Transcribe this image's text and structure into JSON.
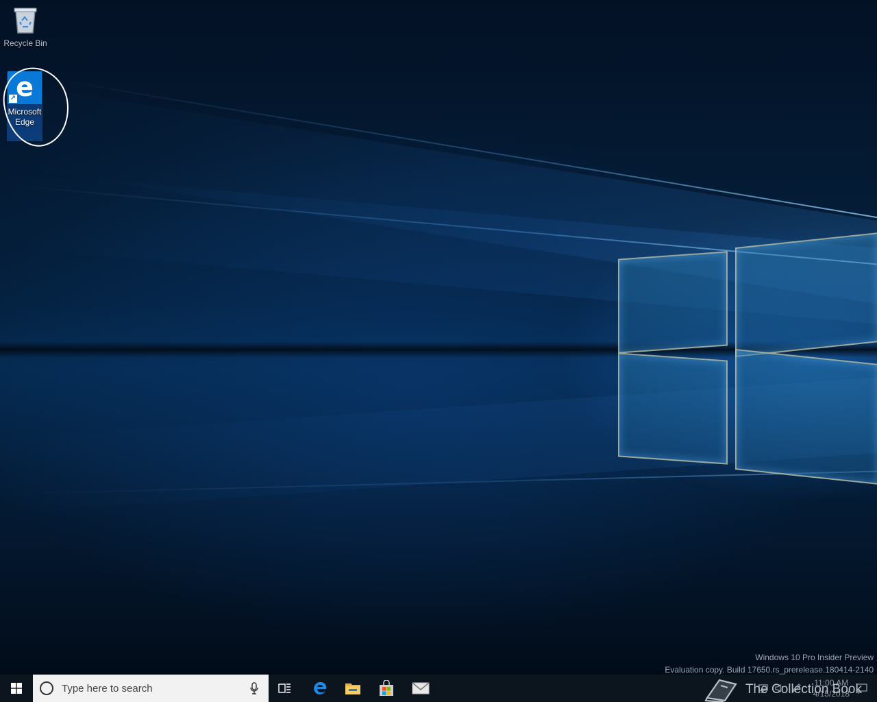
{
  "desktop": {
    "icons": [
      {
        "label": "Recycle Bin",
        "icon": "recycle-bin-icon"
      },
      {
        "label": "Microsoft Edge",
        "label_line1": "Microsoft",
        "label_line2": "Edge",
        "icon": "edge-icon"
      }
    ],
    "watermark": {
      "line1": "Windows 10 Pro Insider Preview",
      "line2": "Evaluation copy. Build 17650.rs_prerelease.180414-2140"
    },
    "annotation_color": "#ffffff"
  },
  "taskbar": {
    "search": {
      "placeholder": "Type here to search"
    },
    "pinned": [
      {
        "name": "task-view",
        "icon": "task-view-icon"
      },
      {
        "name": "edge",
        "icon": "edge-icon"
      },
      {
        "name": "file-explorer",
        "icon": "folder-icon"
      },
      {
        "name": "store",
        "icon": "store-bag-icon"
      },
      {
        "name": "mail",
        "icon": "mail-icon"
      }
    ],
    "clock": {
      "time": "11:00 AM",
      "date": "4/15/2018"
    },
    "tray_icons": [
      "network-icon",
      "volume-icon",
      "pen-icon",
      "action-center-icon"
    ]
  },
  "overlay": {
    "brand_text": "The Collection Book"
  },
  "colors": {
    "taskbar_bg": "#0c141e",
    "accent": "#0a78d7",
    "search_bg": "#f2f2f2"
  }
}
